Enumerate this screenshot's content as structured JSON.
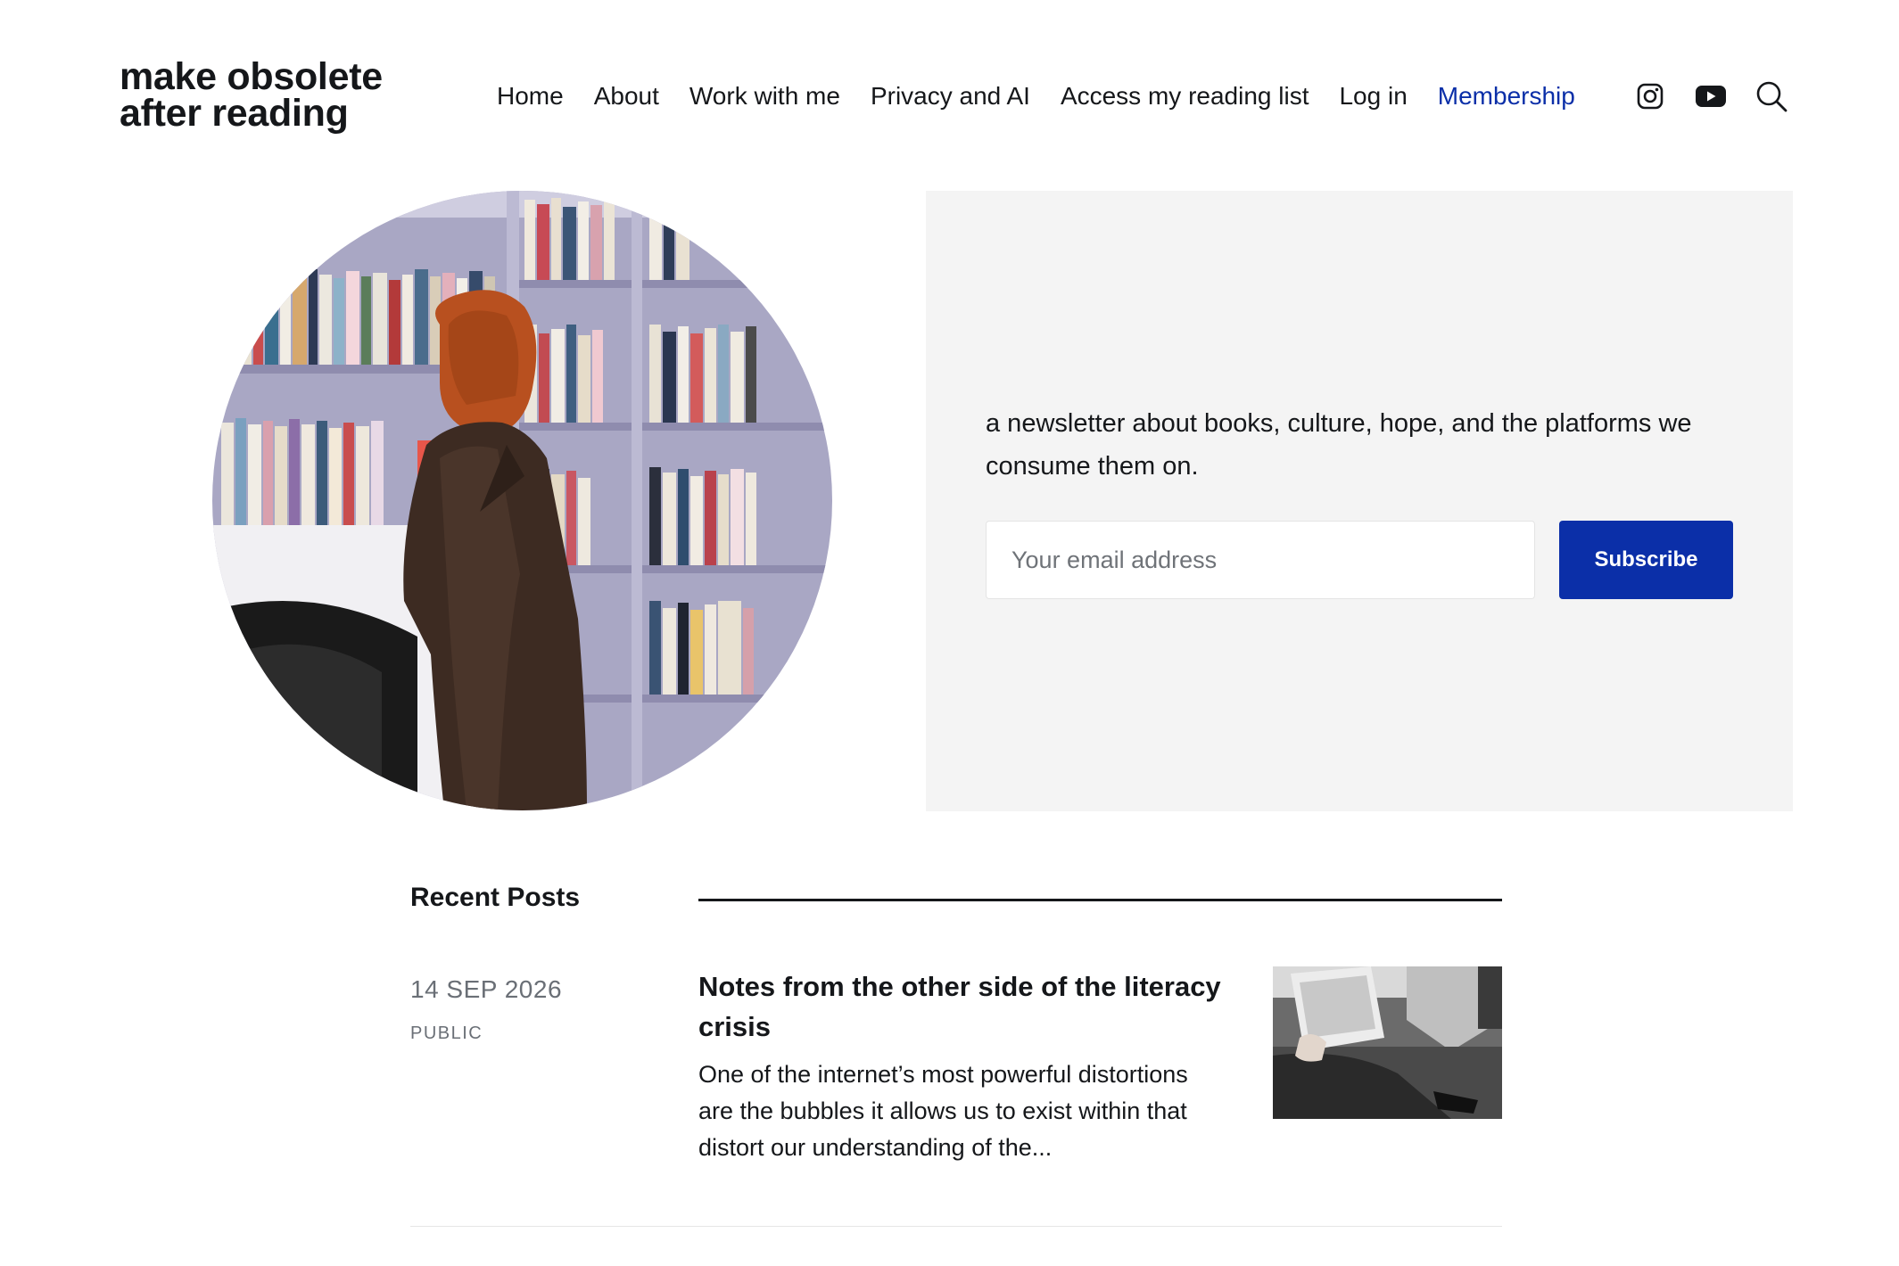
{
  "site": {
    "title_line1": "make obsolete",
    "title_line2": "after reading"
  },
  "nav": {
    "items": [
      "Home",
      "About",
      "Work with me",
      "Privacy and AI",
      "Access my reading list",
      "Log in"
    ],
    "membership": "Membership",
    "icons": [
      "instagram-icon",
      "youtube-icon",
      "search-icon"
    ],
    "accent_color": "#0b2fa8"
  },
  "hero": {
    "tagline": "a newsletter about books, culture, hope, and the platforms we consume them on.",
    "email_placeholder": "Your email address",
    "subscribe_label": "Subscribe",
    "panel_color": "#f4f4f4",
    "button_color": "#0b2fa8"
  },
  "recent_posts": {
    "heading": "Recent Posts",
    "posts": [
      {
        "date": "14 SEP 2026",
        "visibility": "PUBLIC",
        "title": "Notes from the other side of the literacy crisis",
        "excerpt": "One of the internet’s most powerful distortions are the bubbles it allows us to exist within that distort our understanding of the..."
      }
    ]
  }
}
